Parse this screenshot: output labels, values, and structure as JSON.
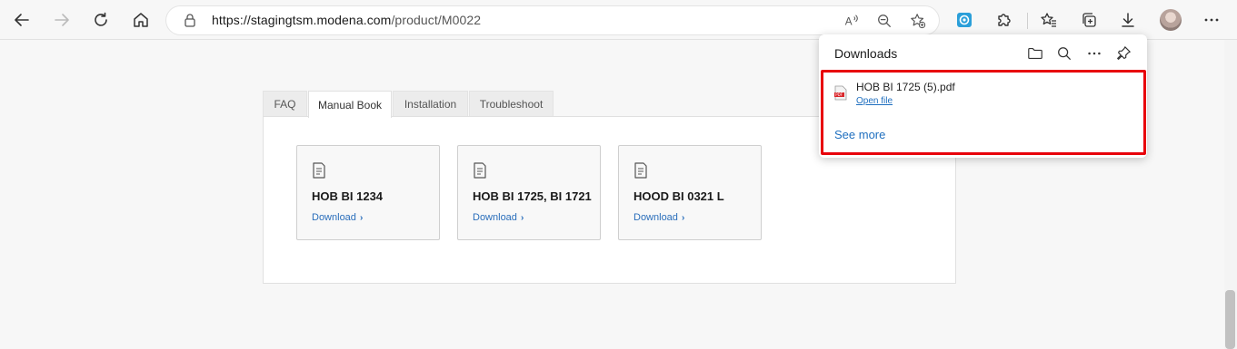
{
  "browser": {
    "url_host": "https://stagingtsm.modena.com",
    "url_path": "/product/M0022"
  },
  "tabs": [
    {
      "label": "FAQ"
    },
    {
      "label": "Manual Book"
    },
    {
      "label": "Installation"
    },
    {
      "label": "Troubleshoot"
    }
  ],
  "active_tab": "Manual Book",
  "cards": [
    {
      "title": "HOB BI 1234",
      "link": "Download"
    },
    {
      "title": "HOB BI 1725, BI 1721",
      "link": "Download"
    },
    {
      "title": "HOOD BI 0321 L",
      "link": "Download"
    }
  ],
  "downloads": {
    "title": "Downloads",
    "item": {
      "filename": "HOB BI 1725 (5).pdf",
      "action": "Open file"
    },
    "see_more": "See more"
  },
  "colors": {
    "highlight": "#e8000b",
    "link": "#1f6fbf"
  }
}
